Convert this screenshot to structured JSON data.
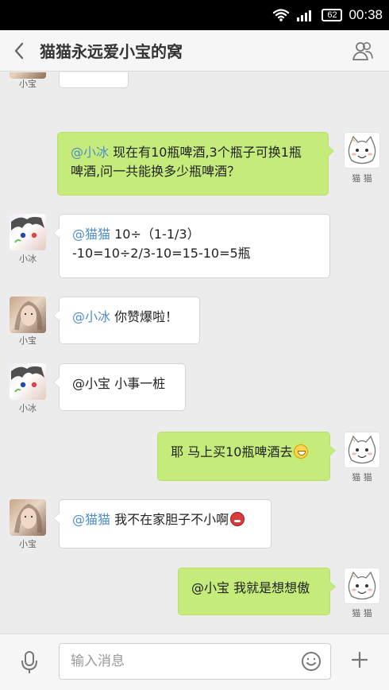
{
  "status_bar": {
    "battery": "62",
    "time": "00:38"
  },
  "header": {
    "title": "猫猫永远爱小宝的窝"
  },
  "avatars": {
    "xiaobao": "小宝",
    "xiaobing": "小冰",
    "maomao": "猫 猫"
  },
  "messages": [
    {
      "mention": "@小冰",
      "text": " 现在有10瓶啤酒,3个瓶子可换1瓶",
      "text2": "啤酒,问一共能换多少瓶啤酒？"
    },
    {
      "mention": "@猫猫",
      "text": " 10÷（1-1/3）",
      "text2": "-10=10÷2/3-10=15-10=5瓶"
    },
    {
      "mention": "@小冰",
      "text": " 你赞爆啦！"
    },
    {
      "text": "@小宝 小事一桩"
    },
    {
      "text": "耶 马上买10瓶啤酒去"
    },
    {
      "mention": "@猫猫",
      "text": " 我不在家胆子不小啊"
    },
    {
      "text": "@小宝 我就是想想傲"
    }
  ],
  "input": {
    "placeholder": "输入消息"
  },
  "colors": {
    "bubble_green": "#c5ec7a",
    "bubble_white": "#ffffff",
    "mention_blue": "#4f8ec9",
    "chat_background": "#ececec"
  },
  "icons": [
    "wifi-icon",
    "signal-icon",
    "battery-icon",
    "back-arrow-icon",
    "group-members-icon",
    "microphone-icon",
    "emoji-icon",
    "plus-icon"
  ]
}
